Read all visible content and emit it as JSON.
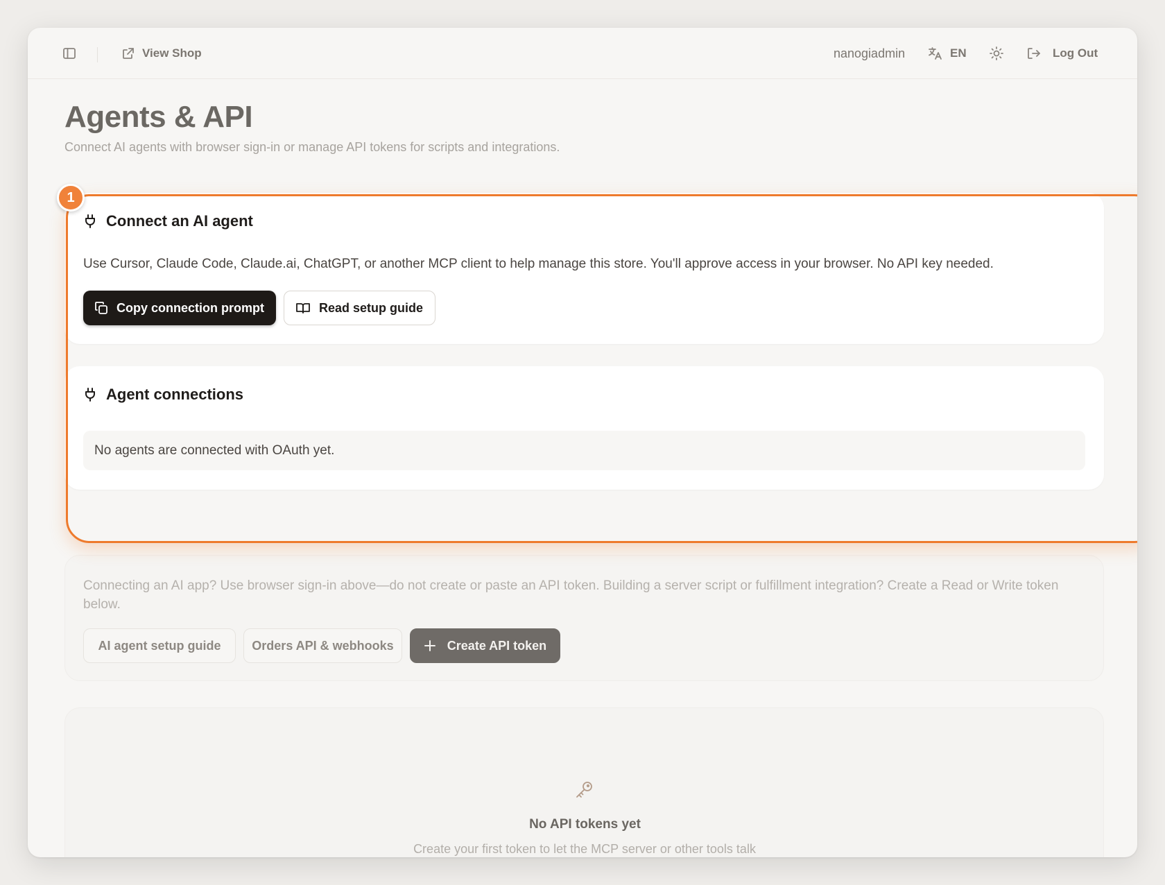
{
  "header": {
    "view_shop": "View Shop",
    "username": "nanogiadmin",
    "language": "EN",
    "logout": "Log Out"
  },
  "page": {
    "title": "Agents & API",
    "subtitle": "Connect AI agents with browser sign-in or manage API tokens for scripts and integrations."
  },
  "annotation": {
    "marker": "1"
  },
  "connect_card": {
    "title": "Connect an AI agent",
    "description": "Use Cursor, Claude Code, Claude.ai, ChatGPT, or another MCP client to help manage this store. You'll approve access in your browser. No API key needed.",
    "copy_button": "Copy connection prompt",
    "guide_button": "Read setup guide"
  },
  "connections_card": {
    "title": "Agent connections",
    "empty_text": "No agents are connected with OAuth yet."
  },
  "api_section": {
    "notice": "Connecting an AI app? Use browser sign-in above—do not create or paste an API token. Building a server script or fulfillment integration? Create a Read or Write token below.",
    "agent_guide_button": "AI agent setup guide",
    "orders_button": "Orders API & webhooks",
    "create_button": "Create API token"
  },
  "tokens": {
    "empty_title": "No API tokens yet",
    "empty_desc": "Create your first token to let the MCP server or other tools talk to this store on your behalf."
  },
  "colors": {
    "accent": "#ee7a2c",
    "primary_button": "#1e1a17",
    "background": "#f7f6f4"
  }
}
